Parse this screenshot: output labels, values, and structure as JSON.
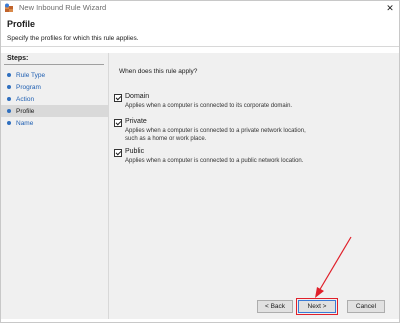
{
  "window": {
    "title": "New Inbound Rule Wizard",
    "close_glyph": "✕"
  },
  "header": {
    "title": "Profile",
    "subtitle": "Specify the profiles for which this rule applies."
  },
  "steps": {
    "title": "Steps:",
    "items": [
      {
        "label": "Rule Type",
        "active": false
      },
      {
        "label": "Program",
        "active": false
      },
      {
        "label": "Action",
        "active": false
      },
      {
        "label": "Profile",
        "active": true
      },
      {
        "label": "Name",
        "active": false
      }
    ]
  },
  "main": {
    "question": "When does this rule apply?",
    "options": [
      {
        "label": "Domain",
        "checked": true,
        "desc": "Applies when a computer is connected to its corporate domain."
      },
      {
        "label": "Private",
        "checked": true,
        "desc": "Applies when a computer is connected to a private network location, such as a home or work place."
      },
      {
        "label": "Public",
        "checked": true,
        "desc": "Applies when a computer is connected to a public network location."
      }
    ]
  },
  "buttons": {
    "back": "< Back",
    "next": "Next >",
    "cancel": "Cancel"
  },
  "colors": {
    "highlight": "#e0202a",
    "link": "#1f5fb2"
  }
}
